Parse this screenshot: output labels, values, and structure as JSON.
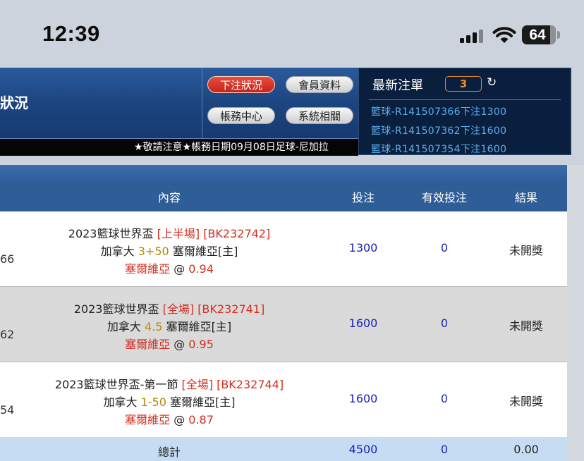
{
  "status_bar": {
    "time": "12:39",
    "battery": "64"
  },
  "header": {
    "title": "狀況",
    "buttons": {
      "bet_status": "下注狀況",
      "member_info": "會員資料",
      "account_center": "帳務中心",
      "system": "系統相關"
    },
    "marquee": "★敬請注意★帳務日期09月08日足球-尼加拉"
  },
  "latest_bets": {
    "title": "最新注單",
    "count": "3",
    "refresh_icon": "↻",
    "items": [
      "籃球-R141507366下注1300",
      "籃球-R141507362下注1600",
      "籃球-R141507354下注1600"
    ]
  },
  "table": {
    "columns": {
      "content": "內容",
      "bet": "投注",
      "valid": "有效投注",
      "result": "結果"
    },
    "rows": [
      {
        "id_tail": "66",
        "league": "2023籃球世界盃",
        "period": "[上半場]",
        "code": "[BK232742]",
        "home": "加拿大",
        "line": "3+50",
        "away": "塞爾維亞[主]",
        "pick": "塞爾維亞",
        "at": "@",
        "odds": "0.94",
        "bet": "1300",
        "valid": "0",
        "result": "未開獎"
      },
      {
        "id_tail": "62",
        "league": "2023籃球世界盃",
        "period": "[全場]",
        "code": "[BK232741]",
        "home": "加拿大",
        "line": "4.5",
        "away": "塞爾維亞[主]",
        "pick": "塞爾維亞",
        "at": "@",
        "odds": "0.95",
        "bet": "1600",
        "valid": "0",
        "result": "未開獎"
      },
      {
        "id_tail": "54",
        "league": "2023籃球世界盃-第一節",
        "period": "[全場]",
        "code": "[BK232744]",
        "home": "加拿大",
        "line": "1-50",
        "away": "塞爾維亞[主]",
        "pick": "塞爾維亞",
        "at": "@",
        "odds": "0.87",
        "bet": "1600",
        "valid": "0",
        "result": "未開獎"
      }
    ],
    "total": {
      "label": "總計",
      "bet": "4500",
      "valid": "0",
      "result": "0.00"
    }
  }
}
